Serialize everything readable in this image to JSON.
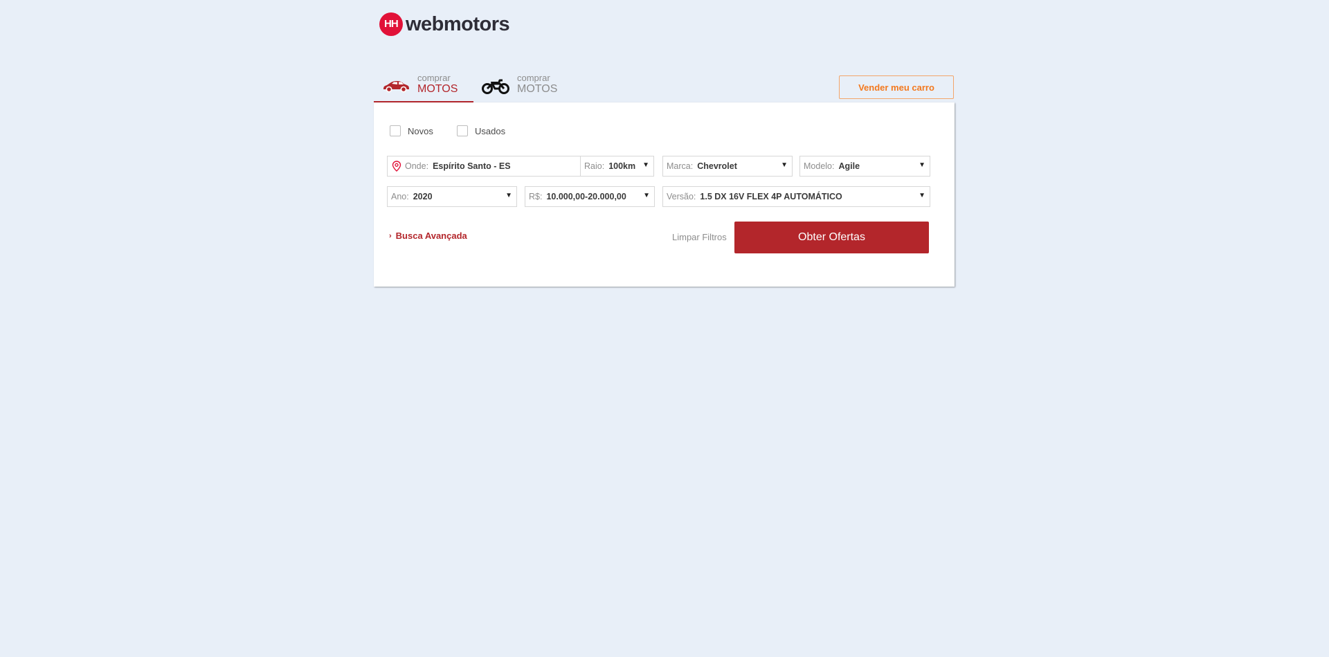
{
  "brand": {
    "logo_text": "webmotors",
    "logo_mark": "HH",
    "color": "#e11138"
  },
  "tabs": [
    {
      "small": "comprar",
      "big": "MOTOS",
      "icon": "car-icon",
      "active": true
    },
    {
      "small": "comprar",
      "big": "MOTOS",
      "icon": "motorcycle-icon",
      "active": false
    }
  ],
  "sell_button": {
    "label": "Vender meu carro"
  },
  "filters": {
    "conditions": [
      {
        "label": "Novos",
        "checked": false
      },
      {
        "label": "Usados",
        "checked": false
      }
    ],
    "location": {
      "label": "Onde:",
      "value": "Espírito Santo - ES",
      "icon": "location-pin-icon"
    },
    "radius": {
      "label": "Raio:",
      "value": "100km"
    },
    "brand": {
      "label": "Marca:",
      "value": "Chevrolet"
    },
    "model": {
      "label": "Modelo:",
      "value": "Agile"
    },
    "year": {
      "label": "Ano:",
      "value": "2020"
    },
    "price": {
      "label": "R$:",
      "value": "10.000,00-20.000,00"
    },
    "version": {
      "label": "Versão:",
      "value": "1.5 DX 16V FLEX 4P AUTOMÁTICO"
    }
  },
  "advanced_search": {
    "label": "Busca Avançada"
  },
  "clear_filters": {
    "label": "Limpar Filtros"
  },
  "submit": {
    "label": "Obter Ofertas"
  },
  "colors": {
    "accent": "#b3262b",
    "sell": "#f3791f",
    "background": "#e8eff8"
  }
}
